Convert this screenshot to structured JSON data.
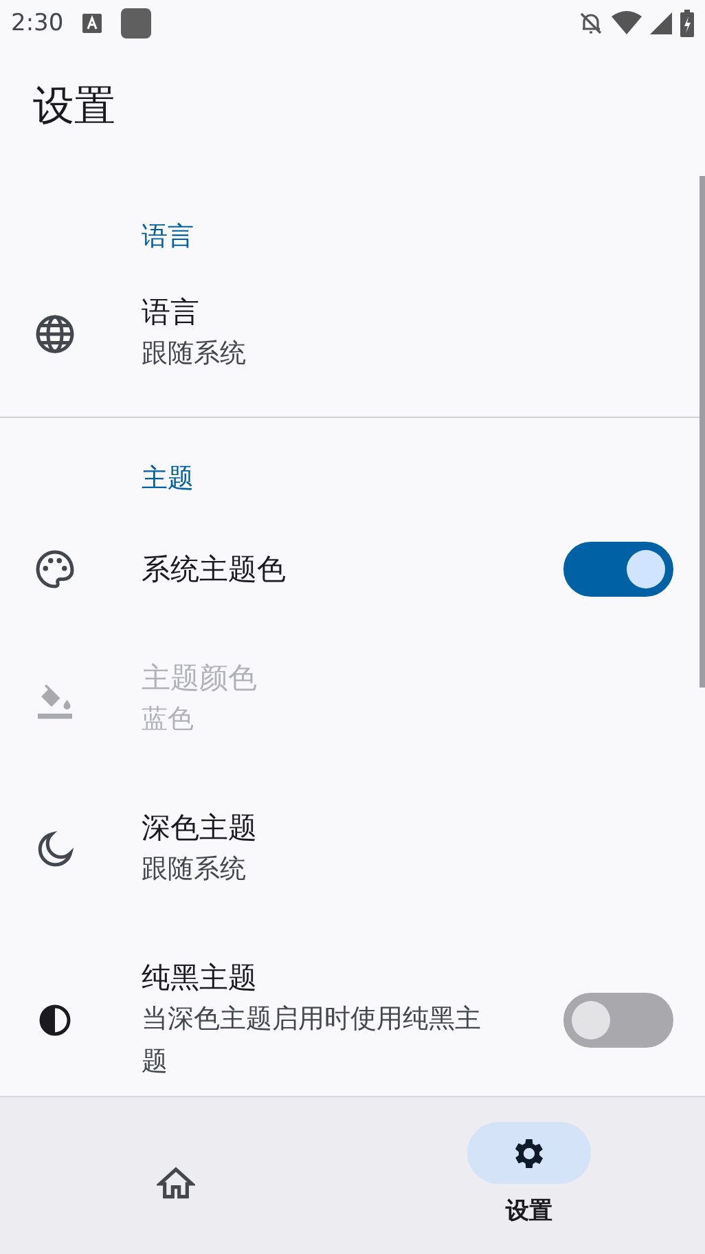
{
  "status_bar": {
    "time": "2:30"
  },
  "title": "设置",
  "sections": [
    {
      "header": "语言",
      "items": [
        {
          "kind": "plain",
          "title": "语言",
          "subtitle": "跟随系统",
          "disabled": false
        }
      ]
    },
    {
      "header": "主题",
      "items": [
        {
          "kind": "switch",
          "title": "系统主题色",
          "on": true,
          "disabled": false
        },
        {
          "kind": "plain",
          "title": "主题颜色",
          "subtitle": "蓝色",
          "disabled": true
        },
        {
          "kind": "plain",
          "title": "深色主题",
          "subtitle": "跟随系统",
          "disabled": false
        },
        {
          "kind": "switch",
          "title": "纯黑主题",
          "subtitle": "当深色主题启用时使用纯黑主题",
          "on": false,
          "disabled": false
        }
      ]
    }
  ],
  "nav": [
    {
      "selected": false
    },
    {
      "label": "设置",
      "selected": true
    }
  ]
}
